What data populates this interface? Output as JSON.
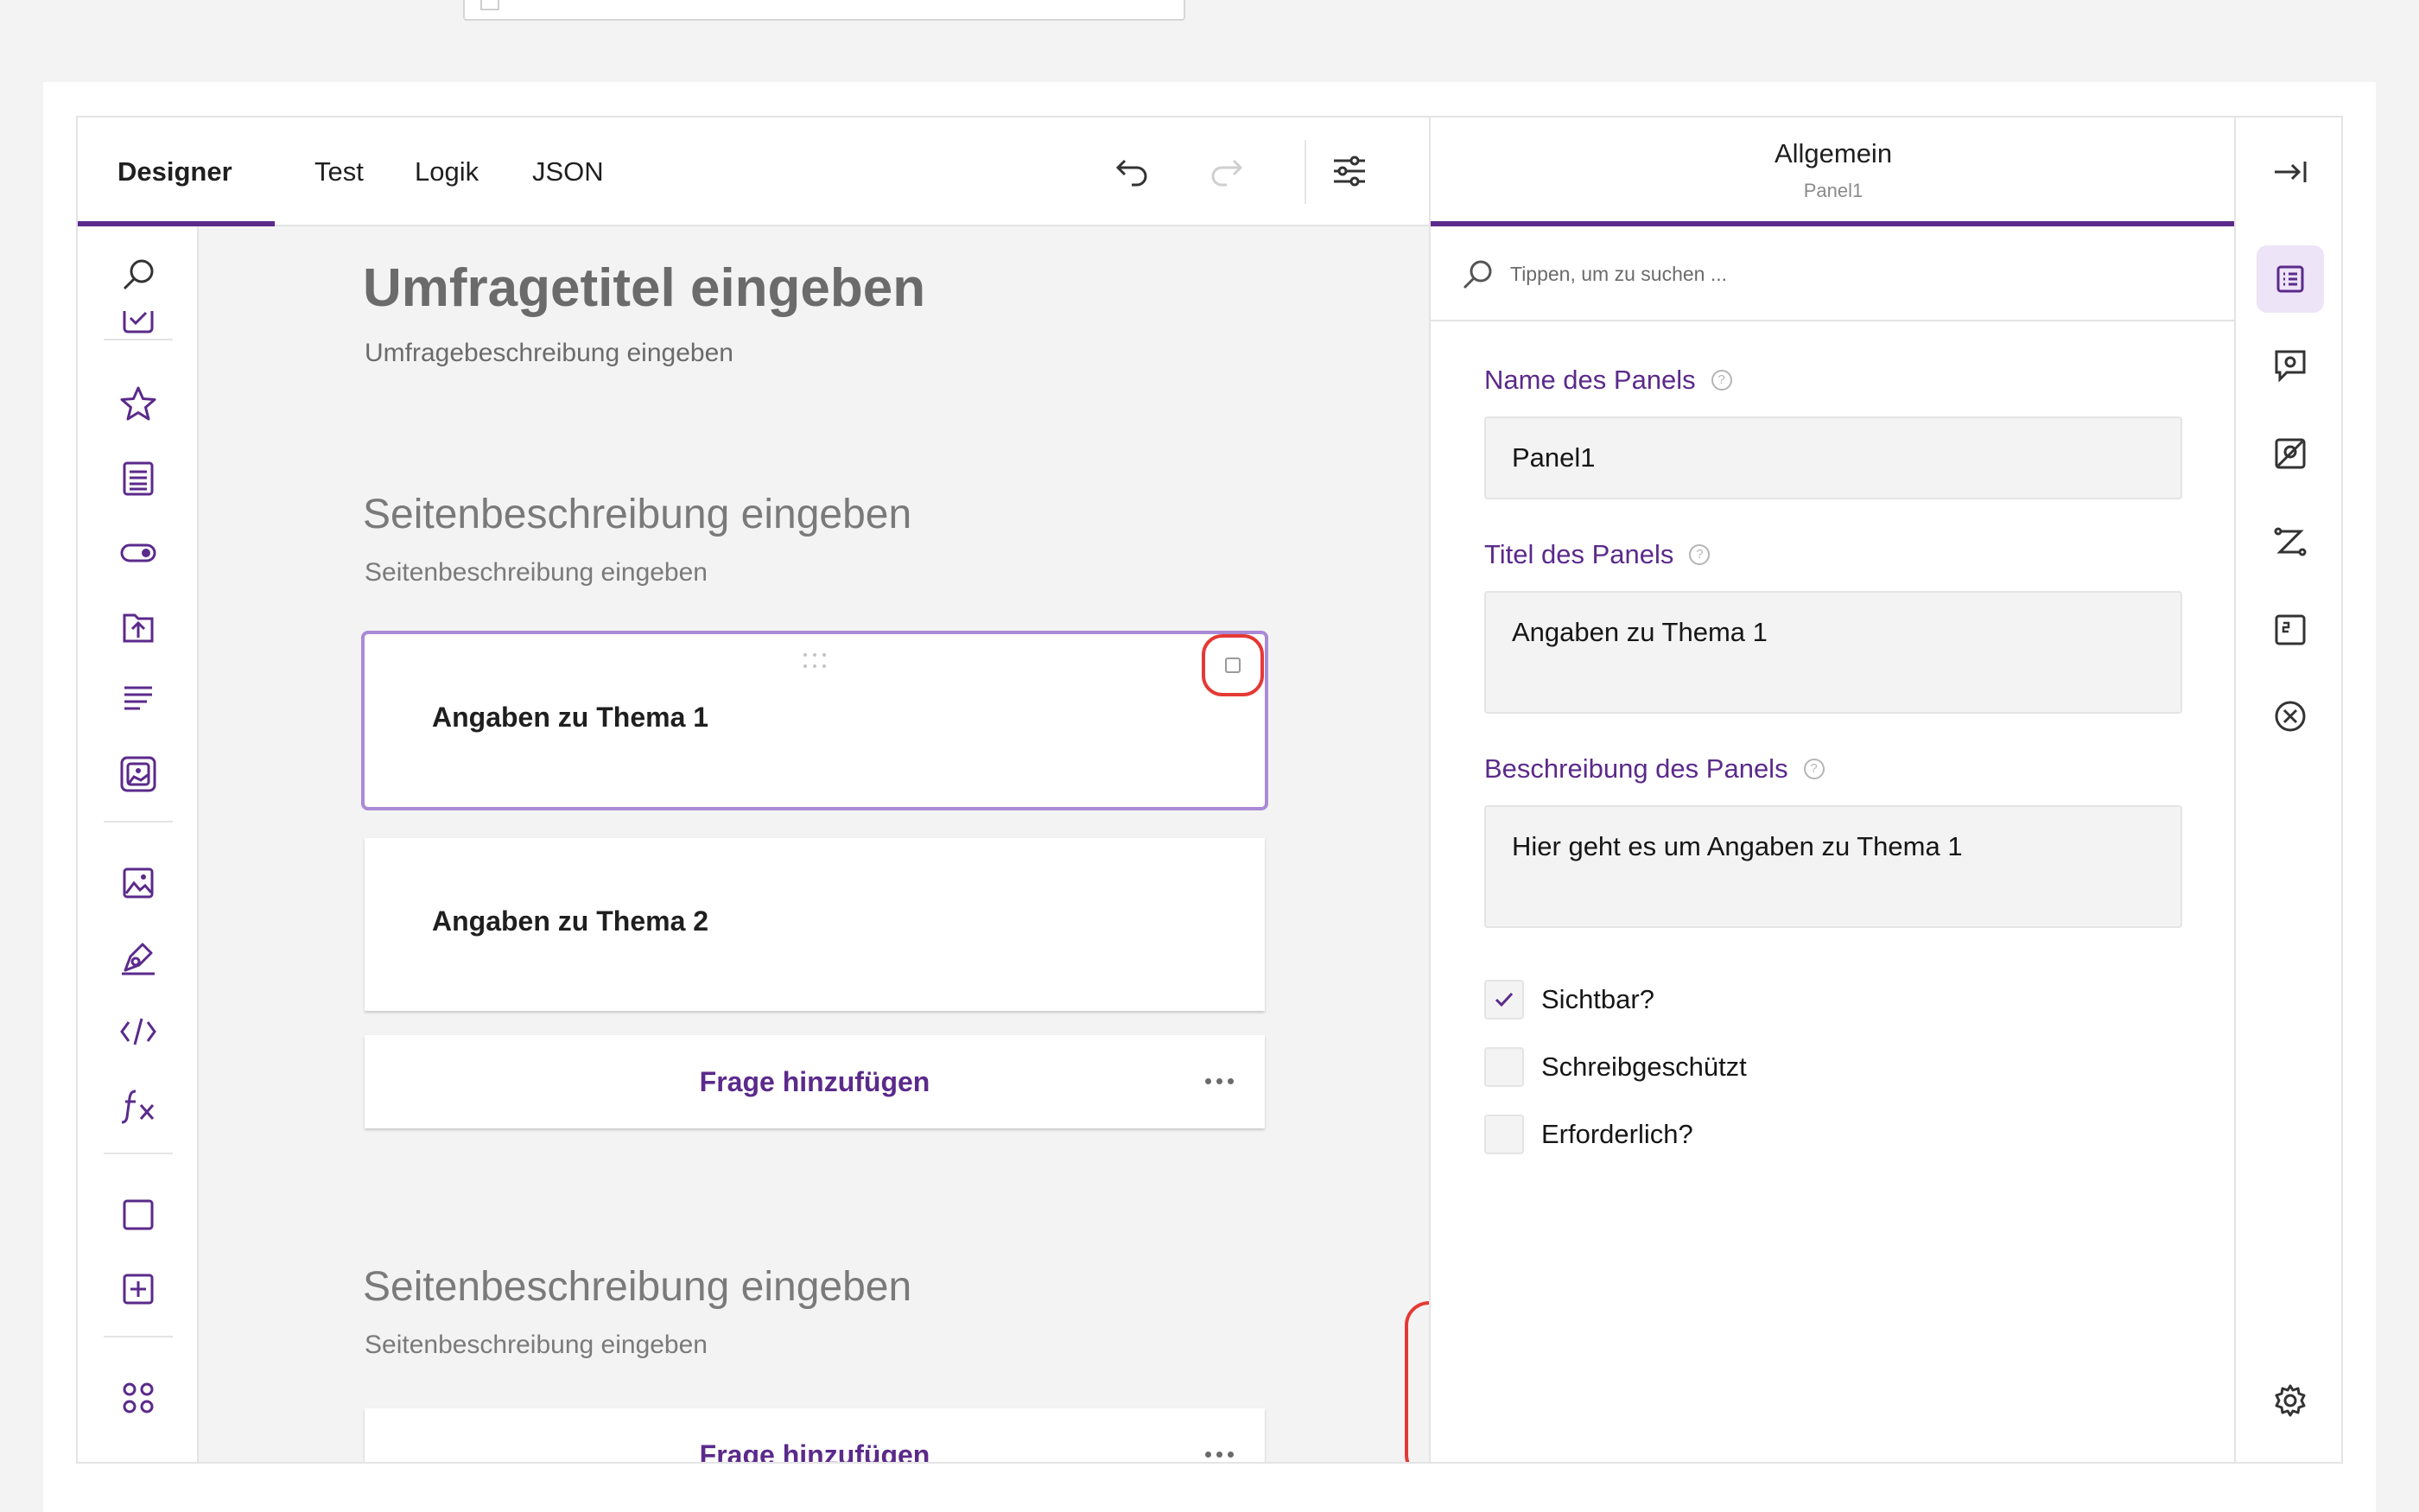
{
  "tabs": [
    {
      "label": "Designer",
      "active": true
    },
    {
      "label": "Test",
      "active": false
    },
    {
      "label": "Logik",
      "active": false
    },
    {
      "label": "JSON",
      "active": false
    }
  ],
  "toolbar_icons": [
    "undo-icon",
    "redo-icon",
    "settings-sliders-icon"
  ],
  "toolbox_icons": [
    "search-icon",
    "checkbox-icon",
    "star-rating-icon",
    "dropdown-list-icon",
    "boolean-toggle-icon",
    "file-upload-icon",
    "comment-text-icon",
    "image-picker-icon",
    "image-icon",
    "signature-pad-icon",
    "html-code-icon",
    "expression-icon",
    "panel-icon",
    "dynamic-panel-icon",
    "more-icon"
  ],
  "survey": {
    "title": "Umfragetitel eingeben",
    "description": "Umfragebeschreibung eingeben"
  },
  "pages": [
    {
      "title": "Seitenbeschreibung eingeben",
      "description": "Seitenbeschreibung eingeben",
      "panels": [
        {
          "title": "Angaben zu Thema 1",
          "selected": true
        },
        {
          "title": "Angaben zu Thema 2",
          "selected": false
        }
      ],
      "add_question": "Frage hinzufügen"
    },
    {
      "title": "Seitenbeschreibung eingeben",
      "description": "Seitenbeschreibung eingeben",
      "add_question": "Frage hinzufügen"
    }
  ],
  "zoom_controls": [
    "zoom-in-icon",
    "zoom-reset-icon",
    "zoom-out-icon",
    "collapse-all-icon",
    "expand-all-icon",
    "lock-question-icon"
  ],
  "property_grid": {
    "header_title": "Allgemein",
    "header_subtitle": "Panel1",
    "search_placeholder": "Tippen, um zu suchen ...",
    "name_label": "Name des Panels",
    "name_value": "Panel1",
    "title_label": "Titel des Panels",
    "title_value": "Angaben zu Thema 1",
    "description_label": "Beschreibung des Panels",
    "description_value": "Hier geht es um Angaben zu Thema 1",
    "help": "?",
    "checkboxes": [
      {
        "label": "Sichtbar?",
        "checked": true
      },
      {
        "label": "Schreibgeschützt",
        "checked": false
      },
      {
        "label": "Erforderlich?",
        "checked": false
      }
    ]
  },
  "right_bar_icons": [
    "collapse-panel-icon",
    "general-properties-icon",
    "logic-icon",
    "conditions-icon",
    "navigation-icon",
    "numbering-icon",
    "validation-icon",
    "settings-gear-icon"
  ],
  "colors": {
    "accent": "#5b2a8b",
    "highlight_ring": "#e53935",
    "selected_outline": "#a98ad6",
    "surface": "#f3f3f3"
  }
}
